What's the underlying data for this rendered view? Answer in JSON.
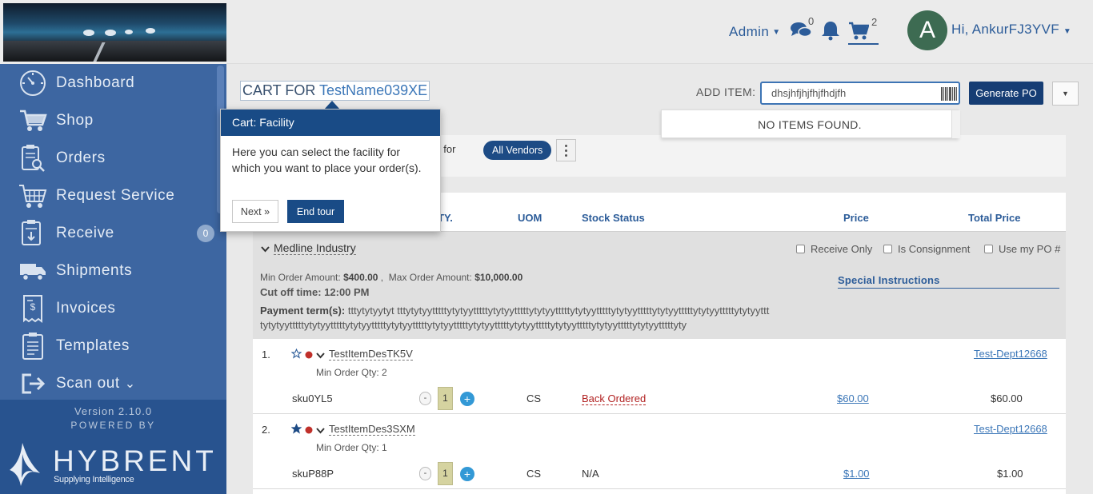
{
  "colors": {
    "accent": "#2c5c99",
    "primary_button": "#163d74",
    "sidebar": "#3d66a1",
    "status_backordered": "#b22222",
    "danger_dot": "#c0302a"
  },
  "sidebar": {
    "items": [
      {
        "label": "Dashboard",
        "icon": "dashboard-gauge-icon"
      },
      {
        "label": "Shop",
        "icon": "shopping-cart-icon"
      },
      {
        "label": "Orders",
        "icon": "clipboard-search-icon"
      },
      {
        "label": "Request Service",
        "icon": "service-cart-icon"
      },
      {
        "label": "Receive",
        "icon": "receive-clipboard-icon",
        "badge": "0"
      },
      {
        "label": "Shipments",
        "icon": "truck-icon"
      },
      {
        "label": "Invoices",
        "icon": "invoice-icon"
      },
      {
        "label": "Templates",
        "icon": "template-clipboard-icon"
      },
      {
        "label": "Scan out",
        "icon": "scan-out-icon"
      }
    ],
    "scan_caret": "⌄",
    "version": "Version 2.10.0",
    "powered_by": "POWERED BY",
    "brand": "HYBRENT",
    "tagline": "Supplying Intelligence"
  },
  "header": {
    "admin_label": "Admin",
    "messages_count": "0",
    "cart_count": "2",
    "avatar_letter": "A",
    "greeting": "Hi, AnkurFJ3YVF"
  },
  "main": {
    "cart_title_prefix": "CART FOR",
    "customer": "TestName039XE",
    "add_item_label": "ADD ITEM:",
    "add_item_value": "dhsjhfjhjfhjfhdjfh",
    "generate_po": "Generate PO",
    "no_items": "NO ITEMS FOUND.",
    "generate_for": "erate for",
    "vendor_filter": "All Vendors"
  },
  "table": {
    "headers": {
      "qty": "QTY.",
      "uom": "UOM",
      "stock": "Stock Status",
      "price": "Price",
      "total": "Total Price"
    },
    "group": {
      "vendor": "Medline Industry",
      "receive_only": "Receive Only",
      "is_consignment": "Is Consignment",
      "use_my_po": "Use my PO #",
      "min_order_label": "Min Order Amount:",
      "min_order": "$400.00",
      "max_order_label": "Max Order Amount:",
      "max_order": "$10,000.00",
      "cutoff": "Cut off time: 12:00 PM",
      "payment_label": "Payment term(s):",
      "payment_line1": "tttytytyytyt tttytytyytttttytytyytttttytytyytttttytytyytttttytytyytttttytytyytttttytytyytttttytytyytttttytytyyttt",
      "payment_line2": "tytytyytttttytytyytttttytytyytttttytytyytttttytytyytttttytytyytttttytytyytttttytytyytttttytytyytttttytytyytttttyty",
      "special_instructions": "Special Instructions"
    },
    "rows": [
      {
        "num": "1.",
        "favorite": false,
        "desc": "TestItemDesTK5V",
        "moq": "Min Order Qty: 2",
        "dept": "Test-Dept12668",
        "sku": "sku0YL5",
        "qty": "1",
        "uom": "CS",
        "status": "Back Ordered",
        "price": "$60.00",
        "total": "$60.00"
      },
      {
        "num": "2.",
        "favorite": true,
        "desc": "TestItemDes3SXM",
        "moq": "Min Order Qty: 1",
        "dept": "Test-Dept12668",
        "sku": "skuP88P",
        "qty": "1",
        "uom": "CS",
        "status": "N/A",
        "price": "$1.00",
        "total": "$1.00"
      }
    ],
    "qty_minus": "-",
    "qty_plus": "+"
  },
  "tour": {
    "title": "Cart: Facility",
    "body": "Here you can select the facility for which you want to place your order(s).",
    "next": "Next »",
    "end": "End tour"
  }
}
